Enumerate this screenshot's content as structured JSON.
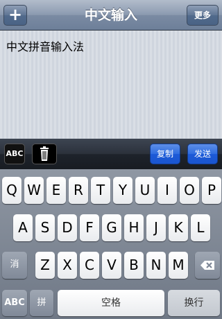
{
  "navbar": {
    "title": "中文输入",
    "add_label": "+",
    "more_label": "更多"
  },
  "editor": {
    "text": "中文拼音输入法"
  },
  "toolbar": {
    "abc_label": "ABC",
    "copy_label": "复制",
    "send_label": "发送"
  },
  "keyboard": {
    "row1": [
      "Q",
      "W",
      "E",
      "R",
      "T",
      "Y",
      "U",
      "I",
      "O",
      "P"
    ],
    "row2": [
      "A",
      "S",
      "D",
      "F",
      "G",
      "H",
      "J",
      "K",
      "L"
    ],
    "row3": [
      "Z",
      "X",
      "C",
      "V",
      "B",
      "N",
      "M"
    ],
    "shift_label": "消",
    "abc_label": "ABC",
    "pinyin_label": "拼",
    "space_label": "空格",
    "return_label": "换行"
  }
}
